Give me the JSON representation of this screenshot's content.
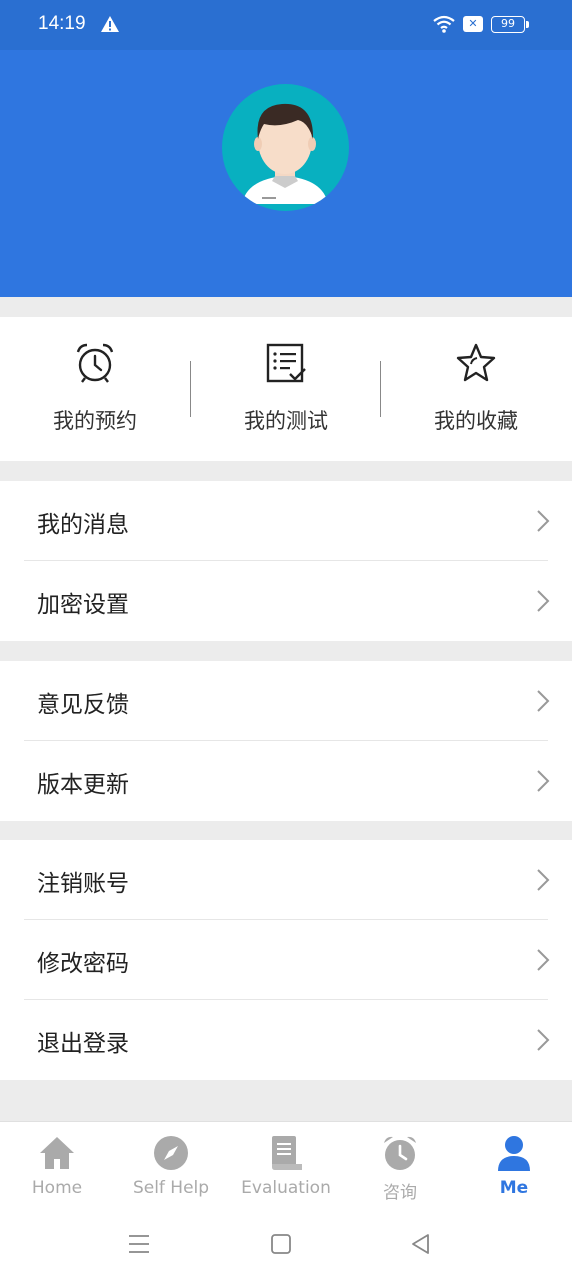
{
  "status_bar": {
    "time": "14:19",
    "battery": "99"
  },
  "quick_actions": [
    {
      "label": "我的预约",
      "icon": "alarm-clock-icon"
    },
    {
      "label": "我的测试",
      "icon": "checklist-icon"
    },
    {
      "label": "我的收藏",
      "icon": "star-icon"
    }
  ],
  "menu": {
    "group1": [
      "我的消息",
      "加密设置"
    ],
    "group2": [
      "意见反馈",
      "版本更新"
    ],
    "group3": [
      "注销账号",
      "修改密码",
      "退出登录"
    ]
  },
  "tabs": [
    {
      "label": "Home",
      "icon": "home-icon"
    },
    {
      "label": "Self Help",
      "icon": "compass-icon"
    },
    {
      "label": "Evaluation",
      "icon": "document-icon"
    },
    {
      "label": "咨询",
      "icon": "clock-icon"
    },
    {
      "label": "Me",
      "icon": "person-icon",
      "active": true
    }
  ],
  "colors": {
    "primary": "#2f76e0",
    "status_bar": "#2a6fd1",
    "avatar_bg": "#08b0c0",
    "inactive": "#aaaaaa"
  }
}
